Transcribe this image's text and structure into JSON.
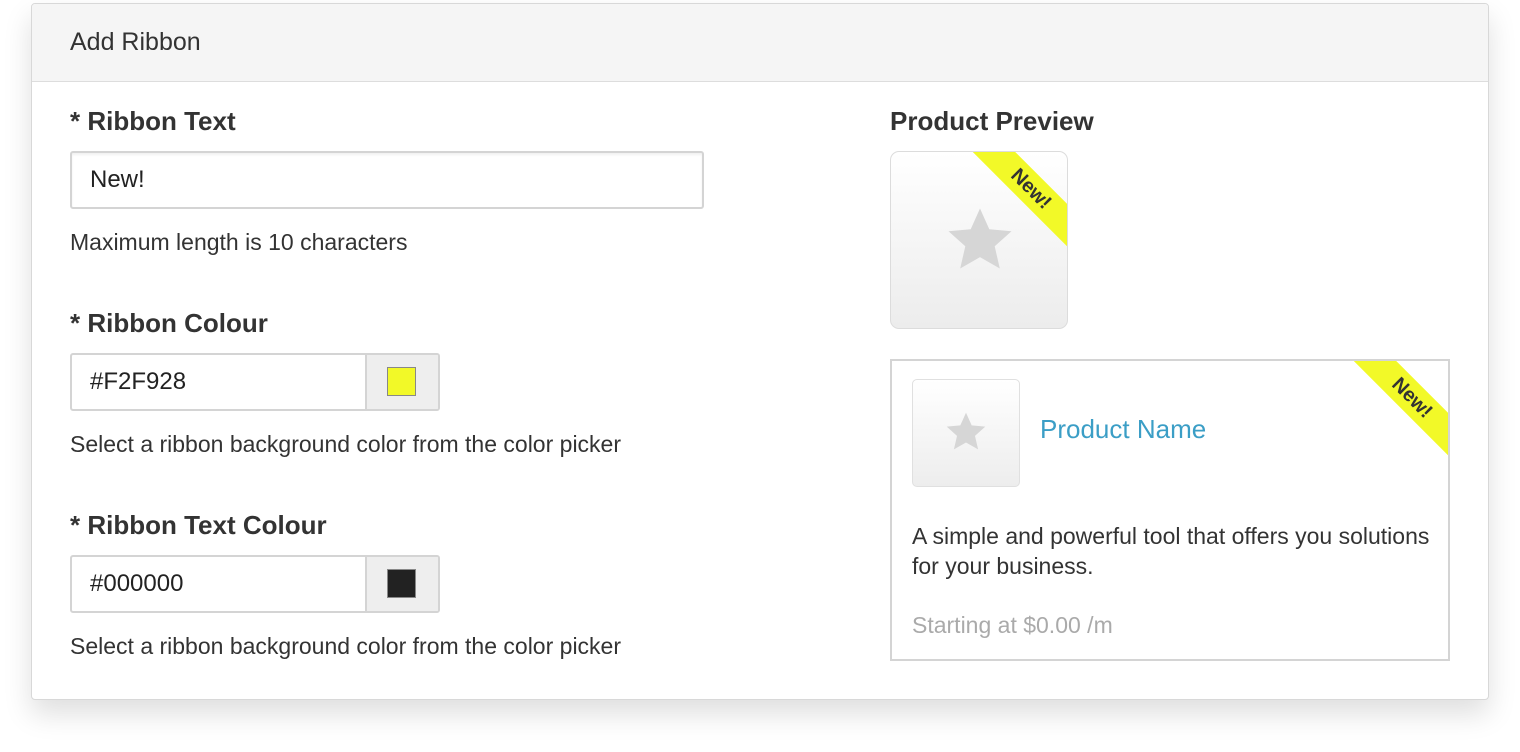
{
  "panel": {
    "title": "Add Ribbon"
  },
  "form": {
    "ribbon_text": {
      "label": "* Ribbon Text",
      "value": "New!",
      "help": "Maximum length is 10 characters"
    },
    "ribbon_colour": {
      "label": "* Ribbon Colour",
      "value": "#F2F928",
      "help": "Select a ribbon background color from the color picker",
      "swatch_color": "#F2F928"
    },
    "ribbon_text_colour": {
      "label": "* Ribbon Text Colour",
      "value": "#000000",
      "help": "Select a ribbon background color from the color picker",
      "swatch_color": "#222222"
    }
  },
  "preview": {
    "title": "Product Preview",
    "tile_ribbon": "New!",
    "card": {
      "ribbon": "New!",
      "product_name": "Product Name",
      "description": "A simple and powerful tool that offers you solutions for your business.",
      "price": "Starting at $0.00 /m"
    },
    "icon": "star-icon"
  },
  "colors": {
    "ribbon_bg": "#F2F928",
    "link": "#3b9ec6",
    "muted": "#aaaaaa"
  }
}
